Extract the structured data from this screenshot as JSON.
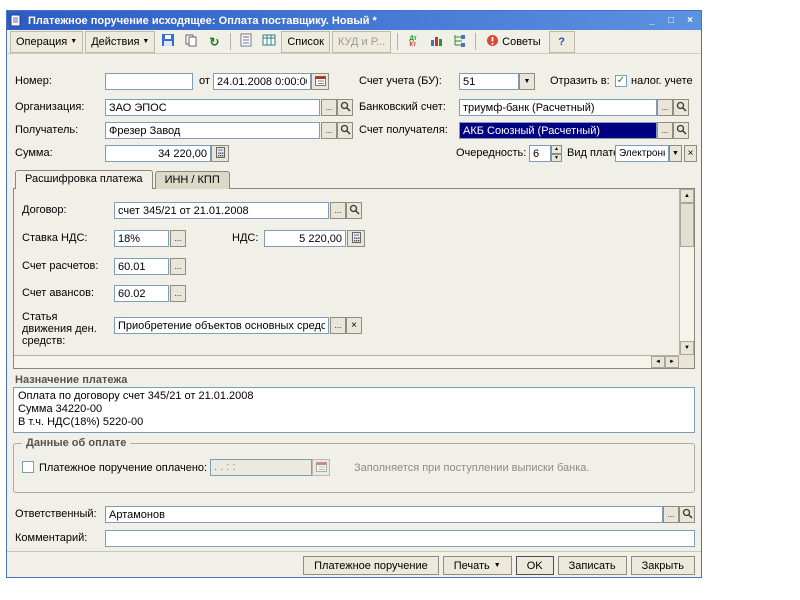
{
  "icons": {
    "dropdown": "▼",
    "spin_up": "▲",
    "spin_down": "▼",
    "scroll_up": "▲",
    "scroll_down": "▼",
    "scroll_left": "◄",
    "scroll_right": "►",
    "ellipsis": "...",
    "clear": "×",
    "check": "✓",
    "minimize": "_",
    "maximize": "□",
    "close": "×",
    "refresh": "↻"
  },
  "window": {
    "title": "Платежное поручение исходящее: Оплата поставщику. Новый *"
  },
  "toolbar": {
    "operation": "Операция",
    "actions": "Действия",
    "list": "Список",
    "kudir": "КУД и Р...",
    "dtkt_top": "Дт",
    "dtkt_bottom": "Кт",
    "advice": "Советы",
    "help": "?"
  },
  "header": {
    "number": {
      "label": "Номер:",
      "value": ""
    },
    "date": {
      "label": "от",
      "value": "24.01.2008 0:00:00"
    },
    "account_bu": {
      "label": "Счет учета (БУ):",
      "value": "51"
    },
    "reflect": {
      "label": "Отразить в:",
      "tax_label": "налог. учете",
      "checked": true
    },
    "organization": {
      "label": "Организация:",
      "value": "ЗАО ЭПОС"
    },
    "bank_account": {
      "label": "Банковский счет:",
      "value": "триумф-банк (Расчетный)"
    },
    "payee": {
      "label": "Получатель:",
      "value": "Фрезер Завод"
    },
    "payee_account": {
      "label": "Счет получателя:",
      "value": "АКБ Союзный (Расчетный)"
    },
    "amount": {
      "label": "Сумма:",
      "value": "34 220,00"
    },
    "priority": {
      "label": "Очередность:",
      "value": "6"
    },
    "payment_kind": {
      "label": "Вид платежа:",
      "value": "Электронно"
    }
  },
  "tabs": {
    "decoding": "Расшифровка платежа",
    "inn_kpp": "ИНН / КПП"
  },
  "decoding": {
    "contract": {
      "label": "Договор:",
      "value": "счет 345/21 от 21.01.2008"
    },
    "vat_rate": {
      "label": "Ставка НДС:",
      "value": "18%"
    },
    "vat": {
      "label": "НДС:",
      "value": "5 220,00"
    },
    "settlement_account": {
      "label": "Счет расчетов:",
      "value": "60.01"
    },
    "advance_account": {
      "label": "Счет авансов:",
      "value": "60.02"
    },
    "cashflow_item": {
      "label": "Статья движения ден. средств:",
      "value": "Приобретение объектов основных средс..."
    }
  },
  "purpose": {
    "label": "Назначение платежа",
    "text": "Оплата по договору счет 345/21 от 21.01.2008\nСумма 34220-00\nВ т.ч. НДС(18%) 5220-00"
  },
  "payment_info": {
    "group_label": "Данные об оплате",
    "paid": {
      "label": "Платежное поручение оплачено:",
      "value": ". .     : :",
      "checked": false
    },
    "hint": "Заполняется при поступлении выписки банка."
  },
  "footer": {
    "responsible": {
      "label": "Ответственный:",
      "value": "Артамонов"
    },
    "comment": {
      "label": "Комментарий:",
      "value": ""
    }
  },
  "actions_bar": {
    "payment_order": "Платежное поручение",
    "print": "Печать",
    "ok": "OK",
    "save": "Записать",
    "close": "Закрыть"
  }
}
